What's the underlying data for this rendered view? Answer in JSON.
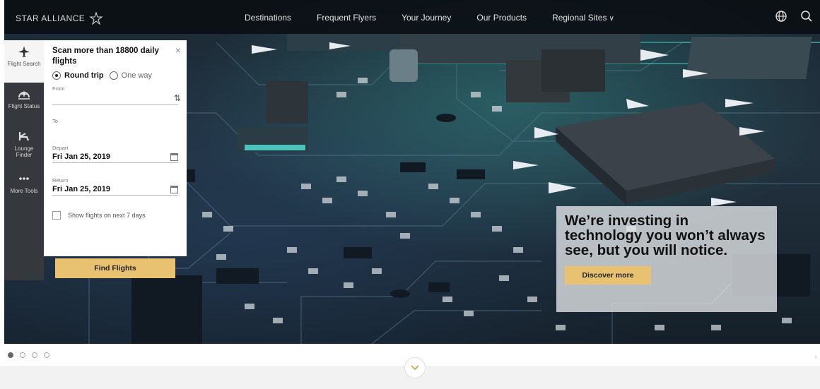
{
  "brand": {
    "name": "STAR ALLIANCE",
    "logo_icon": "star-alliance-logo"
  },
  "nav": {
    "links": [
      "Destinations",
      "Frequent Flyers",
      "Your Journey",
      "Our Products",
      "Regional Sites"
    ],
    "regional_chevron": "∨",
    "icons": [
      "globe-icon",
      "search-icon"
    ]
  },
  "side_tabs": [
    {
      "icon": "plane-icon",
      "label": "Flight Search"
    },
    {
      "icon": "flight-status-icon",
      "label": "Flight Status"
    },
    {
      "icon": "lounge-icon",
      "label": "Lounge Finder"
    },
    {
      "icon": "more-icon",
      "label": "More Tools"
    }
  ],
  "booking": {
    "title": "Scan more than 18800 daily flights",
    "close": "×",
    "trip_types": {
      "round": "Round trip",
      "oneway": "One way"
    },
    "from_label": "From",
    "to_label": "To",
    "swap": "⇅",
    "depart_label": "Depart",
    "depart_value": "Fri Jan 25, 2019",
    "return_label": "Return",
    "return_value": "Fri Jan 25, 2019",
    "flex_label": "Show flights on next 7 days",
    "find_button": "Find Flights"
  },
  "promo": {
    "headline": "We’re investing in technology you won’t always see, but you will notice.",
    "cta": "Discover more"
  },
  "carousel": {
    "slide_count": 4,
    "active_index": 0,
    "next_arrow": "›"
  },
  "colors": {
    "accent": "#e8c270",
    "nav_bg": "#0a0e12",
    "sidetab_bg": "#35383c",
    "glow": "#3cc8b8"
  }
}
